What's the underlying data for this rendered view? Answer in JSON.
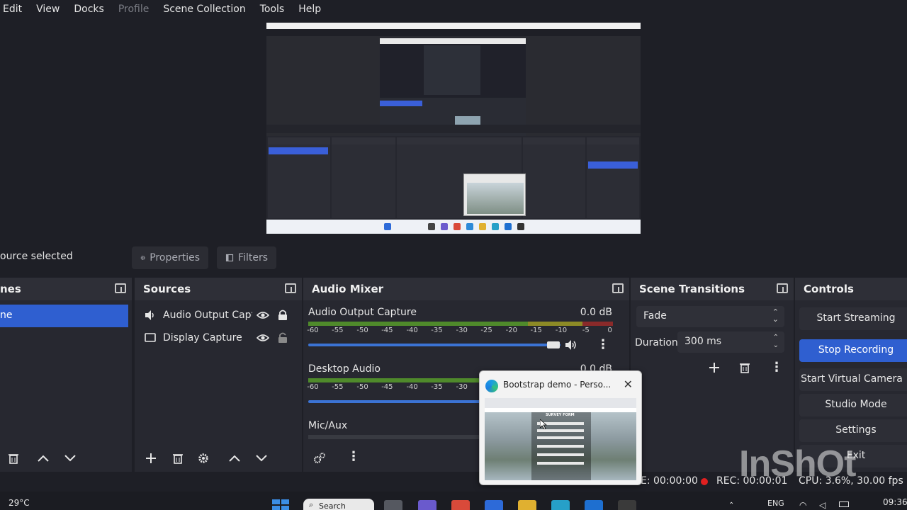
{
  "menu": [
    "Edit",
    "View",
    "Docks",
    "Profile",
    "Scene Collection",
    "Tools",
    "Help"
  ],
  "source_toolbar": {
    "no_source": "ource selected",
    "properties": "Properties",
    "filters": "Filters"
  },
  "scenes": {
    "title": "nes",
    "selected_label": "ne"
  },
  "sources": {
    "title": "Sources",
    "items": [
      {
        "label": "Audio Output Captu",
        "icon": "speaker-icon"
      },
      {
        "label": "Display Capture",
        "icon": "monitor-icon"
      }
    ]
  },
  "audio_mixer": {
    "title": "Audio Mixer",
    "channels": [
      {
        "label": "Audio Output Capture",
        "db": "0.0 dB"
      },
      {
        "label": "Desktop Audio",
        "db": "0.0 dB"
      },
      {
        "label": "Mic/Aux",
        "db": ""
      }
    ],
    "ticks": [
      "-60",
      "-55",
      "-50",
      "-45",
      "-40",
      "-35",
      "-30",
      "-25",
      "-20",
      "-15",
      "-10",
      "-5",
      "0"
    ]
  },
  "scene_transitions": {
    "title": "Scene Transitions",
    "type": "Fade",
    "duration_label": "Duration",
    "duration": "300 ms"
  },
  "controls": {
    "title": "Controls",
    "buttons": [
      "Start Streaming",
      "Stop Recording",
      "Start Virtual Camera",
      "Studio Mode",
      "Settings",
      "Exit"
    ]
  },
  "status": {
    "live": "E: 00:00:00",
    "rec": "REC: 00:00:01",
    "cpu": "CPU: 3.6%, 30.00 fps"
  },
  "popup": {
    "title": "Bootstrap demo - Perso...",
    "thumb_heading": "SURVEY FORM"
  },
  "taskbar": {
    "temperature": "29°C",
    "search": "Search",
    "lang": "ENG",
    "time": "09:36"
  },
  "watermark": "InShOt",
  "colors": {
    "accent": "#2f5fd0",
    "panel": "#272830",
    "background": "#1e1f26",
    "rec": "#e02020"
  }
}
